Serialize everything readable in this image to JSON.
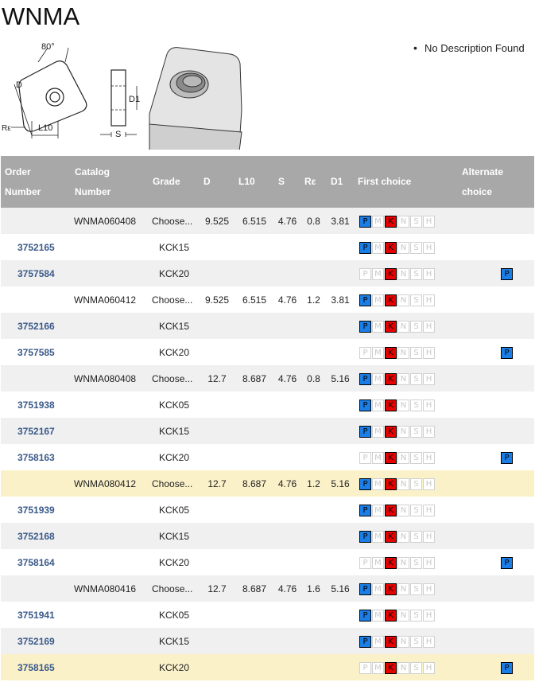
{
  "page": {
    "title": "WNMA"
  },
  "description": {
    "text": "No Description Found"
  },
  "diagram": {
    "labels": {
      "angle": "80°",
      "d": "D",
      "d1": "D1",
      "s": "S",
      "re": "Rε",
      "l10": "L10"
    }
  },
  "table": {
    "headers": {
      "order": [
        "Order",
        "Number"
      ],
      "catalog": [
        "Catalog",
        "Number"
      ],
      "grade": "Grade",
      "d": "D",
      "l10": "L10",
      "s": "S",
      "re": "Rε",
      "d1": "D1",
      "first": "First choice",
      "alternate": [
        "Alternate",
        "choice"
      ]
    },
    "iso_letters": [
      "P",
      "M",
      "K",
      "N",
      "S",
      "H"
    ],
    "rows": [
      {
        "type": "group",
        "order": "",
        "catalog": "WNMA060408",
        "grade": "Choose...",
        "d": "9.525",
        "l10": "6.515",
        "s": "4.76",
        "re": "0.8",
        "d1": "3.81",
        "first": true,
        "alternate": false,
        "shade": "alt"
      },
      {
        "type": "item",
        "order": "3752165",
        "catalog": "",
        "grade": "KCK15",
        "first": true,
        "alternate": false,
        "shade": ""
      },
      {
        "type": "item",
        "order": "3757584",
        "catalog": "",
        "grade": "KCK20",
        "first": false,
        "alternate": true,
        "shade": "alt"
      },
      {
        "type": "group",
        "order": "",
        "catalog": "WNMA060412",
        "grade": "Choose...",
        "d": "9.525",
        "l10": "6.515",
        "s": "4.76",
        "re": "1.2",
        "d1": "3.81",
        "first": true,
        "alternate": false,
        "shade": ""
      },
      {
        "type": "item",
        "order": "3752166",
        "catalog": "",
        "grade": "KCK15",
        "first": true,
        "alternate": false,
        "shade": "alt"
      },
      {
        "type": "item",
        "order": "3757585",
        "catalog": "",
        "grade": "KCK20",
        "first": false,
        "alternate": true,
        "shade": ""
      },
      {
        "type": "group",
        "order": "",
        "catalog": "WNMA080408",
        "grade": "Choose...",
        "d": "12.7",
        "l10": "8.687",
        "s": "4.76",
        "re": "0.8",
        "d1": "5.16",
        "first": true,
        "alternate": false,
        "shade": "alt"
      },
      {
        "type": "item",
        "order": "3751938",
        "catalog": "",
        "grade": "KCK05",
        "first": true,
        "alternate": false,
        "shade": ""
      },
      {
        "type": "item",
        "order": "3752167",
        "catalog": "",
        "grade": "KCK15",
        "first": true,
        "alternate": false,
        "shade": "alt"
      },
      {
        "type": "item",
        "order": "3758163",
        "catalog": "",
        "grade": "KCK20",
        "first": false,
        "alternate": true,
        "shade": ""
      },
      {
        "type": "group",
        "order": "",
        "catalog": "WNMA080412",
        "grade": "Choose...",
        "d": "12.7",
        "l10": "8.687",
        "s": "4.76",
        "re": "1.2",
        "d1": "5.16",
        "first": true,
        "alternate": false,
        "shade": "hl"
      },
      {
        "type": "item",
        "order": "3751939",
        "catalog": "",
        "grade": "KCK05",
        "first": true,
        "alternate": false,
        "shade": ""
      },
      {
        "type": "item",
        "order": "3752168",
        "catalog": "",
        "grade": "KCK15",
        "first": true,
        "alternate": false,
        "shade": "alt"
      },
      {
        "type": "item",
        "order": "3758164",
        "catalog": "",
        "grade": "KCK20",
        "first": false,
        "alternate": true,
        "shade": ""
      },
      {
        "type": "group",
        "order": "",
        "catalog": "WNMA080416",
        "grade": "Choose...",
        "d": "12.7",
        "l10": "8.687",
        "s": "4.76",
        "re": "1.6",
        "d1": "5.16",
        "first": true,
        "alternate": false,
        "shade": "alt"
      },
      {
        "type": "item",
        "order": "3751941",
        "catalog": "",
        "grade": "KCK05",
        "first": true,
        "alternate": false,
        "shade": ""
      },
      {
        "type": "item",
        "order": "3752169",
        "catalog": "",
        "grade": "KCK15",
        "first": true,
        "alternate": false,
        "shade": "alt"
      },
      {
        "type": "item",
        "order": "3758165",
        "catalog": "",
        "grade": "KCK20",
        "first": false,
        "alternate": true,
        "shade": "hl"
      }
    ]
  },
  "colors": {
    "header_bg": "#a8a8a8",
    "p_on": "#1a7ee6",
    "k_on": "#e60000",
    "link": "#3a5a8a",
    "row_alt": "#f0f0f0",
    "row_highlight": "#fbf1c9"
  }
}
